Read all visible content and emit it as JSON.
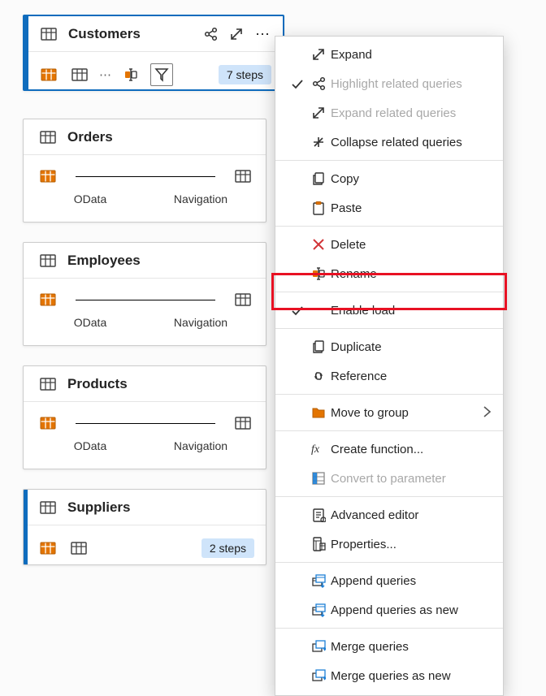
{
  "cards": {
    "customers": {
      "title": "Customers",
      "steps": "7 steps"
    },
    "orders": {
      "title": "Orders",
      "left": "OData",
      "right": "Navigation"
    },
    "employees": {
      "title": "Employees",
      "left": "OData",
      "right": "Navigation"
    },
    "products": {
      "title": "Products",
      "left": "OData",
      "right": "Navigation"
    },
    "suppliers": {
      "title": "Suppliers",
      "steps": "2 steps"
    }
  },
  "menu": {
    "expand": "Expand",
    "highlight_related": "Highlight related queries",
    "expand_related": "Expand related queries",
    "collapse_related": "Collapse related queries",
    "copy": "Copy",
    "paste": "Paste",
    "delete": "Delete",
    "rename": "Rename",
    "enable_load": "Enable load",
    "duplicate": "Duplicate",
    "reference": "Reference",
    "move_to_group": "Move to group",
    "create_function": "Create function...",
    "convert_parameter": "Convert to parameter",
    "advanced_editor": "Advanced editor",
    "properties": "Properties...",
    "append_queries": "Append queries",
    "append_queries_new": "Append queries as new",
    "merge_queries": "Merge queries",
    "merge_queries_new": "Merge queries as new"
  }
}
